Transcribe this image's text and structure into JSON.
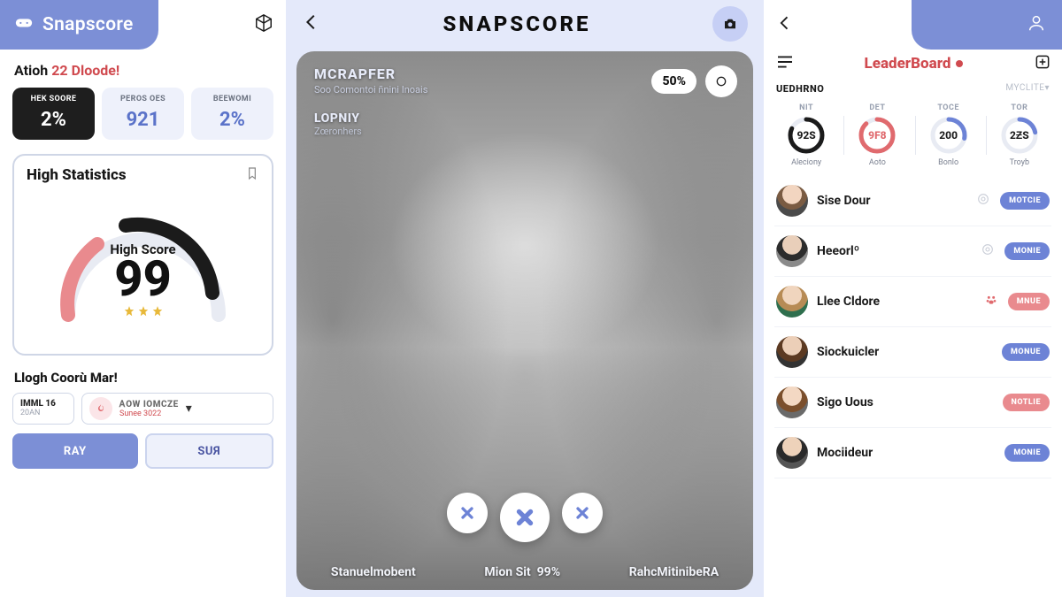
{
  "brand": {
    "name": "Snapscore"
  },
  "left": {
    "greeting": {
      "a": "Atioh ",
      "b": "22 ",
      "c": "Dloode!"
    },
    "stats": [
      {
        "label": "HEK SOORE",
        "value": "2%"
      },
      {
        "label": "PEROS OES",
        "value": "921"
      },
      {
        "label": "BEEWOMI",
        "value": "2%"
      }
    ],
    "high_stats": {
      "title": "High Statistics",
      "caption": "High Score",
      "score": "99"
    },
    "log": {
      "title": "Llogh Coorù Mar!",
      "date_main": "IMML 16",
      "date_sub": "20AN",
      "item_line1": "ᎪOW IOMCZE",
      "item_line2": "Sunee 3022"
    },
    "buttons": {
      "ray": "RAY",
      "sur": "SUЯ"
    }
  },
  "center": {
    "title": "SNAPSCORE",
    "name": "MCRAPFER",
    "subtitle": "Soo Comontoi ñnini Inoais",
    "secondary_name": "LOPNIY",
    "secondary_sub": "Zœronhers",
    "percent": "50%",
    "footer": {
      "left": "Stanuelmobent",
      "mid_a": "Mion Sit",
      "mid_b": "99%",
      "right": "RahcMitinibeRA"
    }
  },
  "right": {
    "title": "LeaderBoard",
    "sub_left": "UEDHRNO",
    "sub_right": "MYCLITE▾",
    "metrics": [
      {
        "head": "NIT",
        "value": "92S",
        "foot": "Aleciony",
        "color": "#1b1b1b",
        "pct": 82
      },
      {
        "head": "DET",
        "value": "9F8",
        "foot": "Aoto",
        "color": "#e06a6e",
        "pct": 88,
        "red_text": true
      },
      {
        "head": "TOCE",
        "value": "200",
        "foot": "Bonlo",
        "color": "#6d83d6",
        "pct": 28
      },
      {
        "head": "TOR",
        "value": "2ƵS",
        "foot": "Troyb",
        "color": "#6d83d6",
        "pct": 22
      }
    ],
    "rows": [
      {
        "name": "Sise Dour",
        "icon": "target",
        "chip": "MOTCIE",
        "chip_style": "blue",
        "av": "av1"
      },
      {
        "name": "Heeorlº",
        "icon": "target",
        "chip": "MONIE",
        "chip_style": "blue",
        "av": "av2"
      },
      {
        "name": "Llee Cldore",
        "icon": "paw",
        "chip": "MNUE",
        "chip_style": "pink",
        "av": "av3"
      },
      {
        "name": "Siockuicler",
        "icon": "",
        "chip": "MONUE",
        "chip_style": "blue",
        "av": "av4"
      },
      {
        "name": "Sigo Uous",
        "icon": "",
        "chip": "NOTLIE",
        "chip_style": "pink",
        "av": "av5"
      },
      {
        "name": "Mociideur",
        "icon": "",
        "chip": "MONIE",
        "chip_style": "blue",
        "av": "av6"
      }
    ]
  }
}
